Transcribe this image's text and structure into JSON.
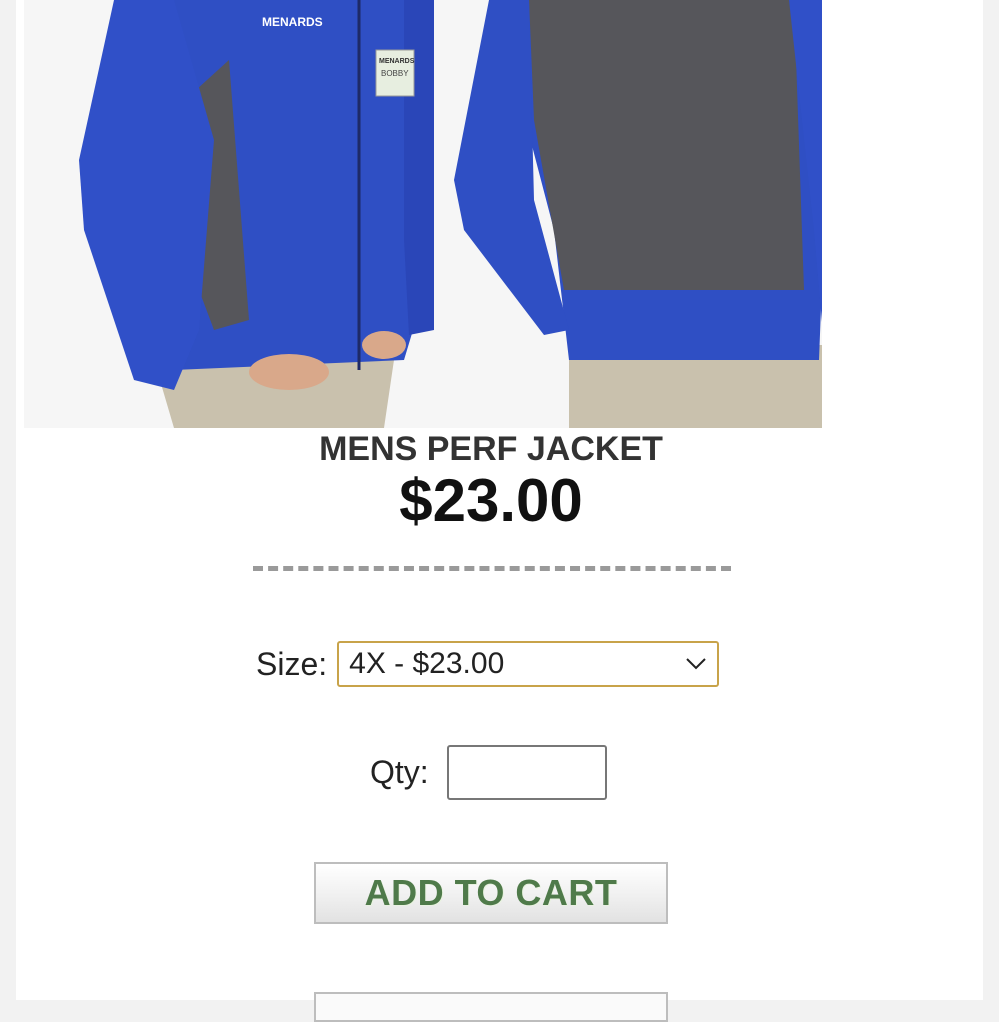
{
  "product": {
    "image_alt": "Mens performance jacket, front and back view",
    "badge_text": "MENARDS",
    "name_tag": "BOBBY",
    "title": "MENS PERF JACKET",
    "price": "$23.00"
  },
  "options": {
    "size_label": "Size:",
    "size_selected": "4X - $23.00",
    "qty_label": "Qty:",
    "qty_value": ""
  },
  "actions": {
    "add_to_cart_label": "ADD TO CART"
  },
  "colors": {
    "jacket_blue": "#2f4fc4",
    "jacket_gray": "#55555a",
    "select_border": "#c8a34a",
    "cart_text": "#4f7a4a"
  }
}
